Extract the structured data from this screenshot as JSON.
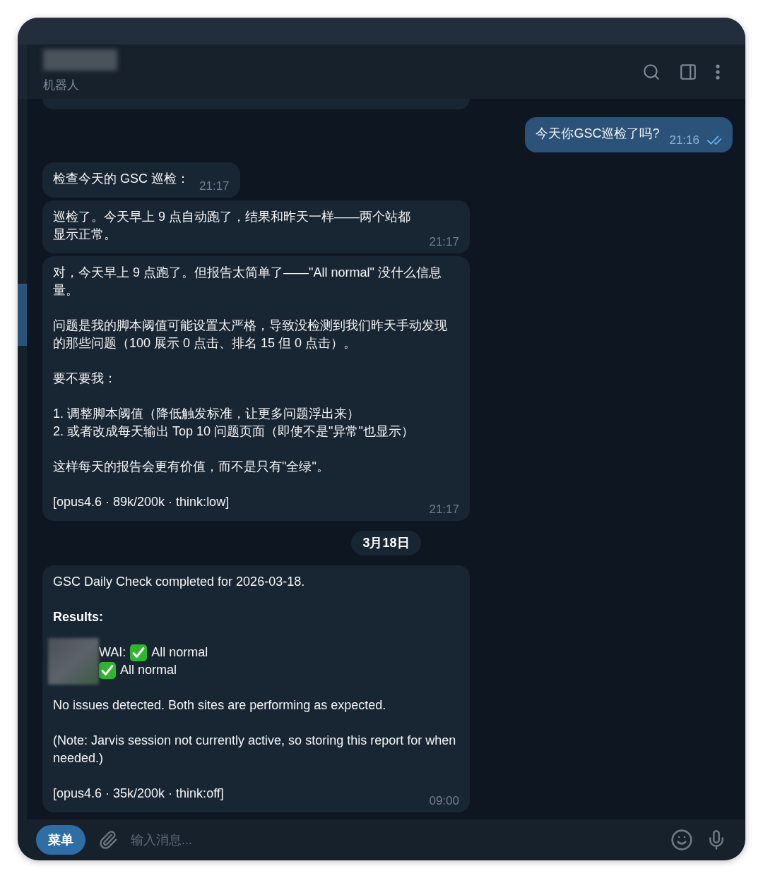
{
  "header": {
    "subtitle": "机器人"
  },
  "chat": [
    {
      "kind": "cut"
    },
    {
      "kind": "outgoing",
      "blocks": [
        {
          "kind": "text",
          "text": "今天你GSC巡检了吗?"
        }
      ],
      "time": "21:16",
      "read": true
    },
    {
      "kind": "incoming",
      "blocks": [
        {
          "kind": "text",
          "text": "检查今天的 GSC 巡检："
        }
      ],
      "time": "21:17"
    },
    {
      "kind": "incoming",
      "blocks": [
        {
          "kind": "text",
          "text": "巡检了。今天早上 9 点自动跑了，结果和昨天一样——两个站都显示正常。"
        }
      ],
      "time": "21:17"
    },
    {
      "kind": "incoming",
      "blocks": [
        {
          "kind": "text",
          "text": "对，今天早上 9 点跑了。但报告太简单了——\"All normal\" 没什么信息量。"
        },
        {
          "kind": "text",
          "text": "问题是我的脚本阈值可能设置太严格，导致没检测到我们昨天手动发现的那些问题（100 展示 0 点击、排名 15 但 0 点击）。"
        },
        {
          "kind": "text",
          "text": "要不要我："
        },
        {
          "kind": "lines",
          "lines": [
            "1. 调整脚本阈值（降低触发标准，让更多问题浮出来）",
            "2. 或者改成每天输出 Top 10 问题页面（即使不是\"异常\"也显示）"
          ]
        },
        {
          "kind": "text",
          "text": "这样每天的报告会更有价值，而不是只有\"全绿\"。"
        },
        {
          "kind": "text",
          "text": "[opus4.6 · 89k/200k · think:low]"
        }
      ],
      "time": "21:17"
    },
    {
      "kind": "date",
      "text": "3月18日"
    },
    {
      "kind": "incoming",
      "blocks": [
        {
          "kind": "text",
          "text": "GSC Daily Check completed for 2026-03-18."
        },
        {
          "kind": "heading",
          "text": "Results:"
        },
        {
          "kind": "status",
          "rows": [
            {
              "label": "WAI:",
              "status": "All normal"
            },
            {
              "label": "",
              "status": "All normal"
            }
          ]
        },
        {
          "kind": "text",
          "text": "No issues detected. Both sites are performing as expected."
        },
        {
          "kind": "text",
          "text": "(Note: Jarvis session not currently active, so storing this report for when needed.)"
        },
        {
          "kind": "text",
          "text": "[opus4.6 · 35k/200k · think:off]"
        }
      ],
      "time": "09:00"
    }
  ],
  "input": {
    "menu_label": "菜单",
    "placeholder": "输入消息..."
  }
}
